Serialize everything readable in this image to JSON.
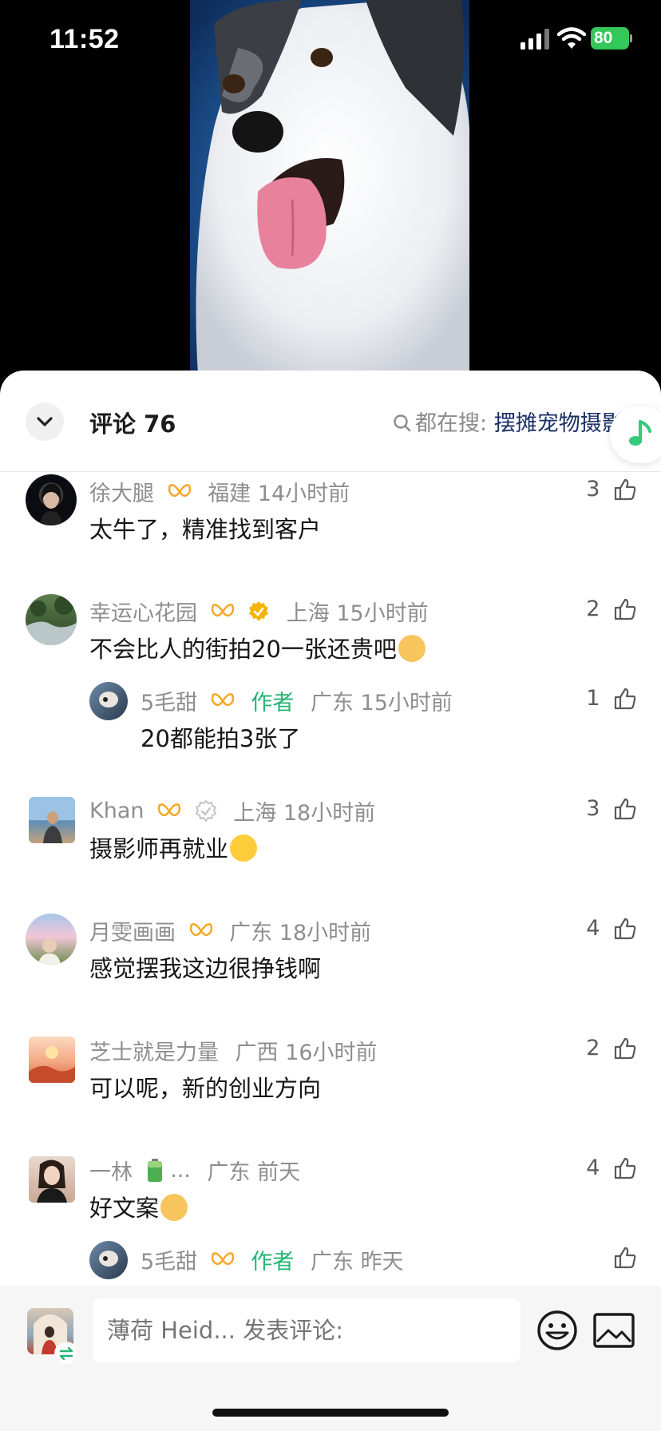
{
  "status_bar": {
    "time": "11:52",
    "battery": "80"
  },
  "header": {
    "comments_label": "评论 76",
    "search_prefix": "都在搜:",
    "search_term": "摆摊宠物摄影"
  },
  "comments": [
    {
      "user": "徐大腿",
      "location": "福建",
      "time": "14小时前",
      "text": "太牛了，精准找到客户",
      "likes": "3"
    },
    {
      "user": "幸运心花园",
      "location": "上海",
      "time": "15小时前",
      "text": "不会比人的街拍20一张还贵吧",
      "likes": "2",
      "reply": {
        "user": "5毛甜",
        "tag": "作者",
        "location": "广东",
        "time": "15小时前",
        "text": "20都能拍3张了",
        "likes": "1"
      }
    },
    {
      "user": "Khan",
      "location": "上海",
      "time": "18小时前",
      "text": "摄影师再就业",
      "likes": "3"
    },
    {
      "user": "月雯画画",
      "location": "广东",
      "time": "18小时前",
      "text": "感觉摆我这边很挣钱啊",
      "likes": "4"
    },
    {
      "user": "芝士就是力量",
      "location": "广西",
      "time": "16小时前",
      "text": "可以呢，新的创业方向",
      "likes": "2"
    },
    {
      "user": "一林",
      "user_suffix": "...",
      "location": "广东",
      "time": "前天",
      "text": "好文案",
      "likes": "4",
      "reply": {
        "user": "5毛甜",
        "tag": "作者",
        "location": "广东",
        "time": "昨天",
        "likes": ""
      }
    }
  ],
  "composer": {
    "placeholder": "薄荷 Heid... 发表评论:"
  },
  "colors": {
    "author_tag": "#22b573",
    "badge_orange": "#f5a623",
    "verified": "#f5b400",
    "search_term": "#1a2f66"
  }
}
